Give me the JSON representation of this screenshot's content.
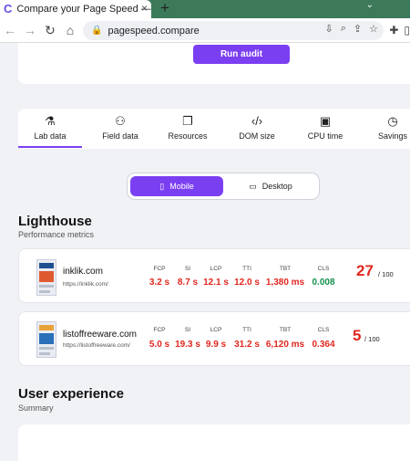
{
  "browser": {
    "tab_title": "Compare your Page Speed — Pa",
    "new_tab": "+",
    "url": "pagespeed.compare"
  },
  "top": {
    "run_audit": "Run audit"
  },
  "tabs": [
    {
      "label": "Lab data",
      "icon": "flask-icon"
    },
    {
      "label": "Field data",
      "icon": "people-icon"
    },
    {
      "label": "Resources",
      "icon": "copy-icon"
    },
    {
      "label": "DOM size",
      "icon": "code-icon"
    },
    {
      "label": "CPU time",
      "icon": "cpu-icon"
    },
    {
      "label": "Savings",
      "icon": "clock-icon"
    }
  ],
  "device_switch": {
    "mobile": "Mobile",
    "desktop": "Desktop"
  },
  "lighthouse": {
    "title": "Lighthouse",
    "subtitle": "Performance metrics"
  },
  "sites": [
    {
      "name": "inklik.com",
      "url": "https://inklik.com/",
      "metrics": [
        {
          "label": "FCP",
          "value": "3.2 s"
        },
        {
          "label": "SI",
          "value": "8.7 s"
        },
        {
          "label": "LCP",
          "value": "12.1 s"
        },
        {
          "label": "TTI",
          "value": "12.0 s"
        },
        {
          "label": "TBT",
          "value": "1,380 ms"
        },
        {
          "label": "CLS",
          "value": "0.008"
        }
      ],
      "score": "27",
      "score_of": "/ 100"
    },
    {
      "name": "listoffreeware.com",
      "url": "https://listoffreeware.com/",
      "metrics": [
        {
          "label": "FCP",
          "value": "5.0 s"
        },
        {
          "label": "SI",
          "value": "19.3 s"
        },
        {
          "label": "LCP",
          "value": "9.9 s"
        },
        {
          "label": "TTI",
          "value": "31.2 s"
        },
        {
          "label": "TBT",
          "value": "6,120 ms"
        },
        {
          "label": "CLS",
          "value": "0.364"
        }
      ],
      "score": "5",
      "score_of": "/ 100"
    }
  ],
  "user_experience": {
    "title": "User experience",
    "subtitle": "Summary"
  },
  "colors": {
    "accent": "#7b3ff2",
    "bad": "#e0271e",
    "good": "#11904a"
  }
}
